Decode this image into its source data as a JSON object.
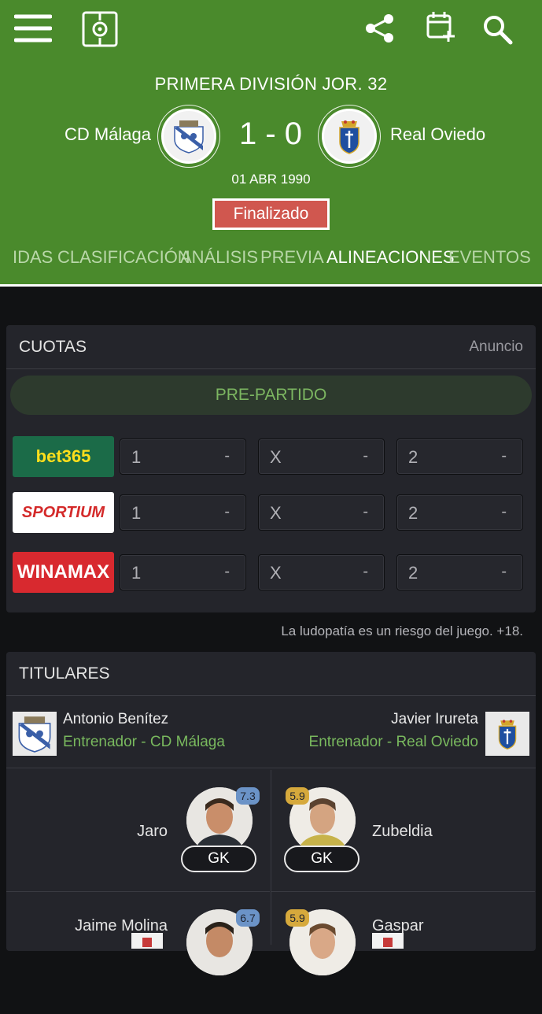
{
  "header": {
    "competition": "PRIMERA DIVISIÓN JOR. 32",
    "home_team": "CD Málaga",
    "away_team": "Real Oviedo",
    "score": "1 - 0",
    "date": "01 ABR 1990",
    "status": "Finalizado",
    "tabs": [
      "IDAS",
      "CLASIFICACIÓN",
      "ANÁLISIS",
      "PREVIA",
      "ALINEACIONES",
      "EVENTOS"
    ],
    "active_tab": "ALINEACIONES",
    "colors": {
      "header_bg": "#4a8a2c",
      "status_bg": "#d0574f"
    }
  },
  "odds": {
    "title": "CUOTAS",
    "ad_label": "Anuncio",
    "pre_match": "PRE-PARTIDO",
    "bookmakers": [
      {
        "name": "bet365",
        "one": "1",
        "one_val": "-",
        "x": "X",
        "x_val": "-",
        "two": "2",
        "two_val": "-"
      },
      {
        "name": "SPORTIUM",
        "one": "1",
        "one_val": "-",
        "x": "X",
        "x_val": "-",
        "two": "2",
        "two_val": "-"
      },
      {
        "name": "WINAMAX",
        "one": "1",
        "one_val": "-",
        "x": "X",
        "x_val": "-",
        "two": "2",
        "two_val": "-"
      }
    ],
    "disclaimer": "La ludopatía es un riesgo del juego. +18."
  },
  "lineups": {
    "title": "TITULARES",
    "home_coach": {
      "name": "Antonio Benítez",
      "role": "Entrenador - CD Málaga"
    },
    "away_coach": {
      "name": "Javier Irureta",
      "role": "Entrenador - Real Oviedo"
    },
    "players": [
      {
        "home_name": "Jaro",
        "home_rating": "7.3",
        "home_pos": "GK",
        "away_name": "Zubeldia",
        "away_rating": "5.9",
        "away_pos": "GK"
      },
      {
        "home_name": "Jaime Molina",
        "home_rating": "6.7",
        "away_name": "Gaspar",
        "away_rating": "5.9"
      }
    ],
    "colors": {
      "rating_good": "#6b93c7",
      "rating_avg": "#d6a93c",
      "role_text": "#79b95e"
    }
  }
}
